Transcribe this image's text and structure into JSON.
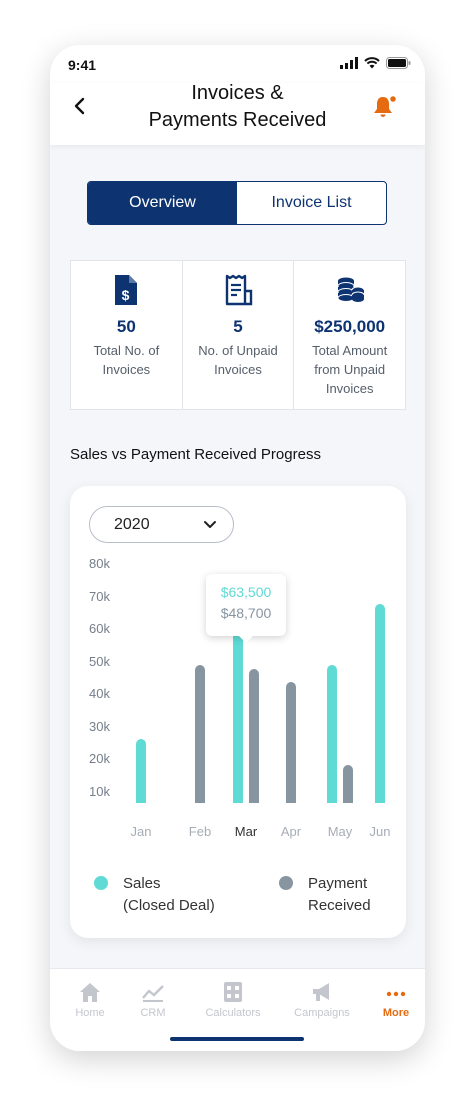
{
  "status_bar": {
    "time": "9:41"
  },
  "header": {
    "title_line1": "Invoices &",
    "title_line2": "Payments Received"
  },
  "segmented": {
    "overview": "Overview",
    "invoice_list": "Invoice List"
  },
  "stats": [
    {
      "value": "50",
      "label": "Total No. of Invoices",
      "icon": "dollar-document-icon"
    },
    {
      "value": "5",
      "label": "No. of Unpaid Invoices",
      "icon": "receipt-icon"
    },
    {
      "value": "$250,000",
      "label": "Total Amount from Unpaid Invoices",
      "icon": "coin-stack-icon"
    }
  ],
  "section_title": "Sales vs Payment Received Progress",
  "year_select": {
    "value": "2020"
  },
  "tooltip": {
    "sales": "$63,500",
    "payment": "$48,700"
  },
  "legend": {
    "sales_line1": "Sales",
    "sales_line2": "(Closed Deal)",
    "payment_line1": "Payment",
    "payment_line2": "Received"
  },
  "chart_data": {
    "type": "bar",
    "categories": [
      "Jan",
      "Feb",
      "Mar",
      "Apr",
      "May",
      "Jun"
    ],
    "y_ticks": [
      "80k",
      "70k",
      "60k",
      "50k",
      "40k",
      "30k",
      "20k",
      "10k"
    ],
    "ylim": [
      0,
      80000
    ],
    "selected_category": "Mar",
    "series": [
      {
        "name": "Sales (Closed Deal)",
        "color": "#5fdad4",
        "values": [
          28000,
          null,
          63500,
          null,
          50000,
          68000
        ]
      },
      {
        "name": "Payment Received",
        "color": "#8795a1",
        "values": [
          null,
          50000,
          48700,
          45000,
          20000,
          null
        ]
      }
    ]
  },
  "tabbar": [
    {
      "label": "Home",
      "icon": "home-icon"
    },
    {
      "label": "CRM",
      "icon": "chart-line-icon"
    },
    {
      "label": "Calculators",
      "icon": "calculator-icon"
    },
    {
      "label": "Campaigns",
      "icon": "megaphone-icon"
    },
    {
      "label": "More",
      "icon": "more-dots-icon",
      "active": true
    }
  ],
  "colors": {
    "primary": "#0d3470",
    "accent": "#e66a10",
    "sales": "#5fdad4",
    "payment": "#8795a1"
  }
}
